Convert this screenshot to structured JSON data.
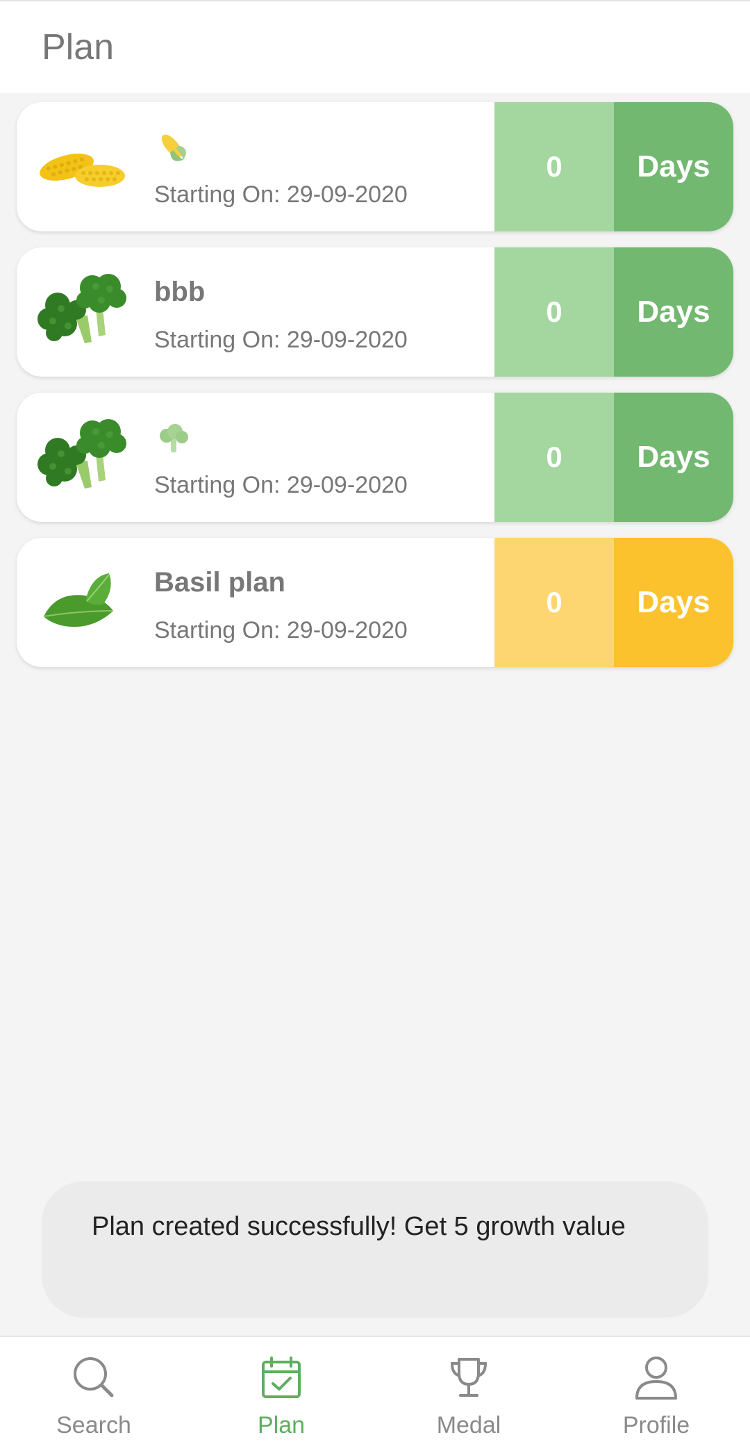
{
  "header": {
    "title": "Plan"
  },
  "plans": [
    {
      "name": "",
      "name_icon": "corn-icon",
      "thumb": "corn-icon",
      "start_label": "Starting On:",
      "start_date": "29-09-2020",
      "count": "0",
      "unit": "Days",
      "status": "green"
    },
    {
      "name": "bbb",
      "name_icon": "",
      "thumb": "broccoli-icon",
      "start_label": "Starting On:",
      "start_date": "29-09-2020",
      "count": "0",
      "unit": "Days",
      "status": "green"
    },
    {
      "name": "",
      "name_icon": "broccoli-icon",
      "thumb": "broccoli-icon",
      "start_label": "Starting On:",
      "start_date": "29-09-2020",
      "count": "0",
      "unit": "Days",
      "status": "green"
    },
    {
      "name": "Basil plan",
      "name_icon": "",
      "thumb": "basil-leaf-icon",
      "start_label": "Starting On:",
      "start_date": "29-09-2020",
      "count": "0",
      "unit": "Days",
      "status": "yellow"
    }
  ],
  "colors": {
    "green_light": "#a3d79f",
    "green_dark": "#72b870",
    "yellow_light": "#fdd571",
    "yellow_dark": "#fcc22e",
    "active_nav": "#5fae5f"
  },
  "toast": {
    "message": "Plan created successfully! Get 5 growth value"
  },
  "bottom_nav": {
    "items": [
      {
        "label": "Search",
        "icon": "search-icon",
        "active": false
      },
      {
        "label": "Plan",
        "icon": "calendar-check-icon",
        "active": true
      },
      {
        "label": "Medal",
        "icon": "trophy-icon",
        "active": false
      },
      {
        "label": "Profile",
        "icon": "person-icon",
        "active": false
      }
    ]
  }
}
